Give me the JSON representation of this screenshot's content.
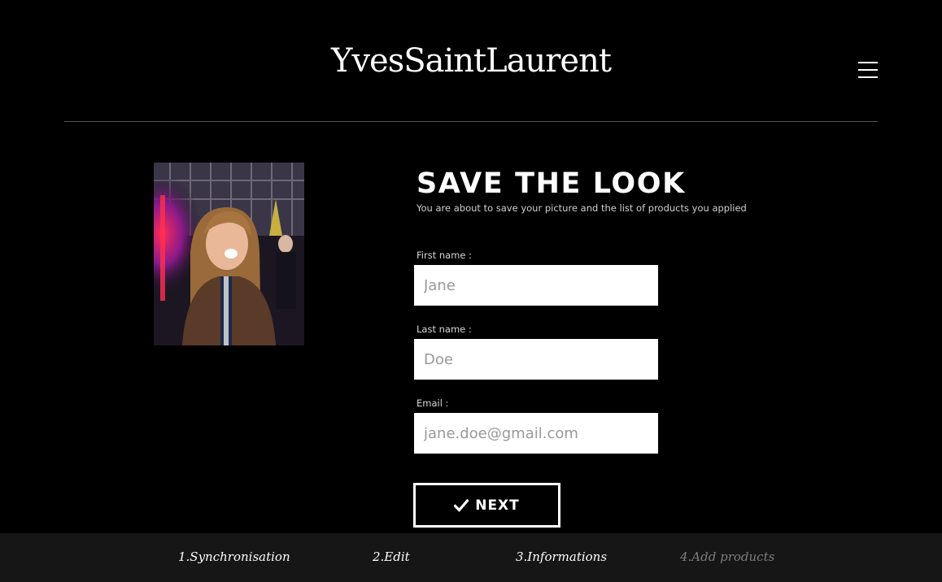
{
  "brand": {
    "logo_text": "YvesSaintLaurent"
  },
  "header": {
    "menu_icon": "hamburger-menu-icon"
  },
  "main": {
    "title": "SAVE THE LOOK",
    "subtitle": "You are about to save your picture and the list of products you applied"
  },
  "form": {
    "first_name": {
      "label": "First name :",
      "placeholder": "Jane",
      "value": ""
    },
    "last_name": {
      "label": "Last name :",
      "placeholder": "Doe",
      "value": ""
    },
    "email": {
      "label": "Email :",
      "placeholder": "jane.doe@gmail.com",
      "value": ""
    }
  },
  "actions": {
    "next_label": "NEXT",
    "next_icon": "checkmark-icon"
  },
  "steps": [
    {
      "label": "1.Synchronisation",
      "active": true
    },
    {
      "label": "2.Edit",
      "active": true
    },
    {
      "label": "3.Informations",
      "active": true
    },
    {
      "label": "4.Add products",
      "active": false
    }
  ],
  "colors": {
    "background": "#000000",
    "foreground": "#ffffff",
    "step_bar": "#161616",
    "step_inactive": "#7d7d7d"
  }
}
